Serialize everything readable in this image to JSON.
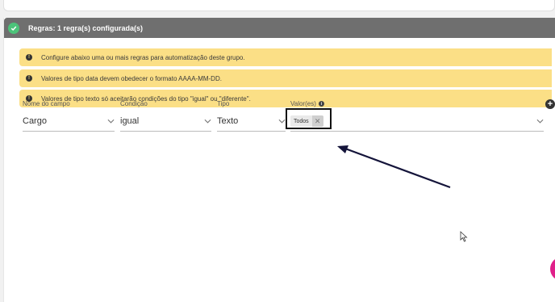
{
  "panel": {
    "title": "Regras: 1 regra(s) configurada(s)"
  },
  "alerts": [
    "Configure abaixo uma ou mais regras para automatização deste grupo.",
    "Valores de tipo data devem obedecer o formato AAAA-MM-DD.",
    "Valores de tipo texto só aceitarão condições do tipo \"igual\" ou \"diferente\"."
  ],
  "rule": {
    "field_label": "Nome do campo",
    "field_value": "Cargo",
    "condition_label": "Condição",
    "condition_value": "igual",
    "type_label": "Tipo",
    "type_value": "Texto",
    "values_label": "Valor(es)",
    "values_chips": [
      "Todos"
    ]
  },
  "colors": {
    "header_bg": "#6f6f6f",
    "success": "#4cc37a",
    "alert_bg": "#fbdf86",
    "fab": "#e0208a"
  }
}
